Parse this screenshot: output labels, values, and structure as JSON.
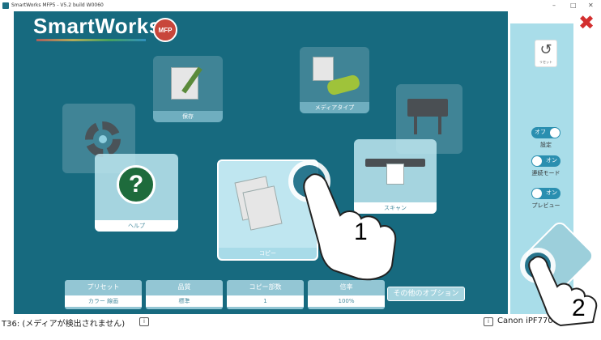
{
  "window": {
    "title": "SmartWorks MFP5 - V5.2 build W0060",
    "minimize": "–",
    "maximize": "□",
    "close": "✕"
  },
  "header": {
    "logo_text": "SmartWorks",
    "logo_badge": "MFP"
  },
  "tiles": {
    "setting_label": "",
    "scan_doc_label": "保存",
    "media_type_label": "メディアタイプ",
    "printer_label": "",
    "help_label": "ヘルプ",
    "copy_label": "コピー",
    "scan_label": "スキャン"
  },
  "options": {
    "items": [
      {
        "title": "プリセット",
        "value": "カラー 線画"
      },
      {
        "title": "品質",
        "value": "標準"
      },
      {
        "title": "コピー部数",
        "value": "1"
      },
      {
        "title": "倍率",
        "value": "100%"
      }
    ],
    "other_label": "その他のオプション"
  },
  "sidebar": {
    "reset_label": "リセット",
    "toggles": [
      {
        "state": "オフ",
        "caption": "設定",
        "on": false
      },
      {
        "state": "オン",
        "caption": "連続モード",
        "on": true
      },
      {
        "state": "オン",
        "caption": "プレビュー",
        "on": true
      }
    ],
    "close_icon": "✖"
  },
  "status": {
    "left_text": "T36: (メディアが検出されません)",
    "info_glyph": "i",
    "right_text": "Canon iPF770: ✓"
  },
  "annotations": {
    "step1": "1",
    "step2": "2"
  },
  "colors": {
    "background": "#176a7f",
    "tile_highlight": "#bfe6f0",
    "sidebar_panel": "#a9dde9",
    "close": "#d32f2f",
    "toggle_on": "#2a8fb0",
    "toggle_off": "#2a8fb0"
  }
}
